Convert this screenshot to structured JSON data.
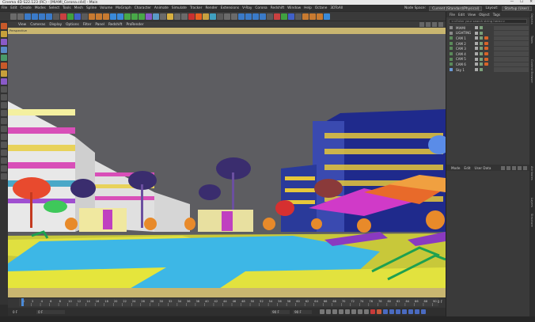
{
  "window": {
    "title": "Cinema 4D S22.123 (RC) - [MIAMI_Corona.c4d] - Main",
    "controls": [
      "—",
      "☐",
      "✕"
    ]
  },
  "menubar": {
    "items": [
      "File",
      "Edit",
      "Create",
      "Modes",
      "Select",
      "Tools",
      "Mesh",
      "Spline",
      "Volume",
      "MoGraph",
      "Character",
      "Animate",
      "Simulate",
      "Tracker",
      "Render",
      "Extensions",
      "V-Ray",
      "Corona",
      "Redshift",
      "Window",
      "Help",
      "Octane",
      "3DToAll"
    ],
    "node_space_label": "Node Space:",
    "node_space_value": "Current (Standard/Physical)",
    "layout_label": "Layout:",
    "layout_value": "Startup (User)"
  },
  "viewport": {
    "menu": [
      "View",
      "Cameras",
      "Display",
      "Options",
      "Filter",
      "Panel",
      "Redshift",
      "ProRender"
    ],
    "camera_tag": "Perspective",
    "colors": {
      "sky": "#5d5d61",
      "border": "#c9b670"
    }
  },
  "timeline": {
    "ticks": [
      "0",
      "2",
      "4",
      "6",
      "8",
      "10",
      "12",
      "14",
      "16",
      "18",
      "20",
      "22",
      "24",
      "26",
      "28",
      "30",
      "32",
      "34",
      "36",
      "38",
      "40",
      "42",
      "44",
      "46",
      "48",
      "50",
      "52",
      "54",
      "56",
      "58",
      "60",
      "62",
      "64",
      "66",
      "68",
      "70",
      "72",
      "74",
      "76",
      "78",
      "80",
      "82",
      "84",
      "86",
      "88",
      "90"
    ],
    "end_label": "0 F"
  },
  "controls": {
    "start_frame": "0 F",
    "start_field": "0 F",
    "end_field": "90 F",
    "end_field2": "90 F"
  },
  "object_manager": {
    "menu": [
      "File",
      "Edit",
      "View",
      "Object",
      "Tags"
    ],
    "search_placeholder": "<<Enter your search string here>>",
    "rows": [
      {
        "label": "MIAMI"
      },
      {
        "label": "LIGHTING"
      },
      {
        "label": "CAM 1"
      },
      {
        "label": "CAM 2"
      },
      {
        "label": "CAM 3"
      },
      {
        "label": "CAM 4"
      },
      {
        "label": "CAM 5"
      },
      {
        "label": "CAM 6"
      },
      {
        "label": "Sky 1"
      }
    ]
  },
  "attributes": {
    "menu": [
      "Mode",
      "Edit",
      "User Data"
    ]
  },
  "side_tabs": [
    "Objects",
    "Takes",
    "Content Browser",
    "Attributes",
    "Layers",
    "Structure"
  ]
}
